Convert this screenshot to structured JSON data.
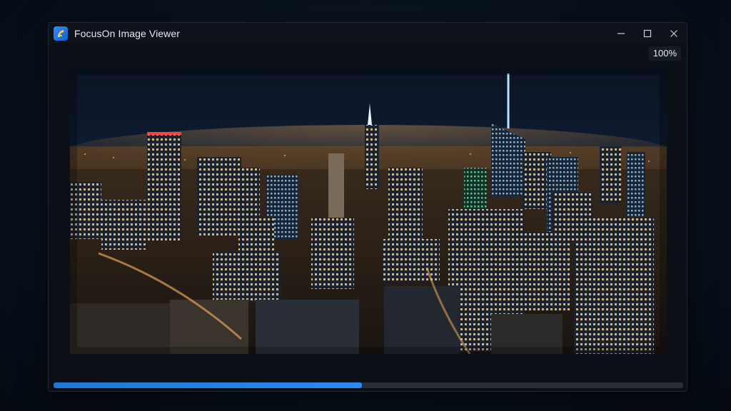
{
  "window": {
    "title": "FocusOn Image Viewer",
    "app_icon": "focuson-logo-icon",
    "controls": {
      "minimize_icon": "minimize-icon",
      "maximize_icon": "maximize-icon",
      "close_icon": "close-icon"
    }
  },
  "viewer": {
    "zoom_label": "100%",
    "image_subject": "night-city-skyline"
  },
  "progress": {
    "fraction": 0.49,
    "accent_color": "#1e78d6"
  }
}
